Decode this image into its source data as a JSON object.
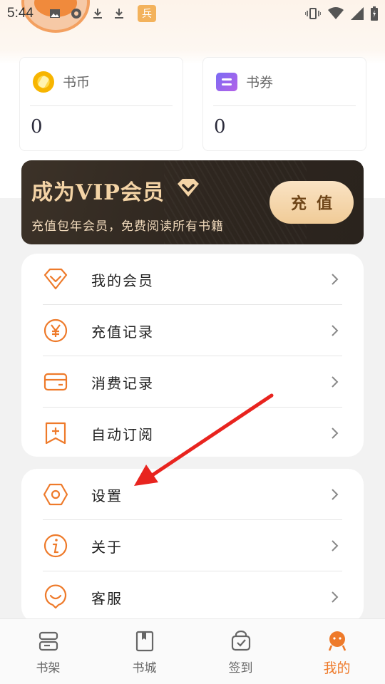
{
  "status_bar": {
    "time": "5:44",
    "notif_pill": "兵"
  },
  "wallet": {
    "coins": {
      "label": "书币",
      "value": "0",
      "icon": "coin-icon"
    },
    "tickets": {
      "label": "书券",
      "value": "0",
      "icon": "ticket-icon"
    }
  },
  "vip_banner": {
    "title": "成为VIP会员",
    "subtitle": "充值包年会员，免费阅读所有书籍",
    "button_label": "充值",
    "colors": {
      "title": "#f4d4a6",
      "button_bg": "#f0cb97",
      "background": "#2e261f"
    }
  },
  "menu_group_1": [
    {
      "label": "我的会员",
      "icon": "diamond-icon"
    },
    {
      "label": "充值记录",
      "icon": "yen-icon"
    },
    {
      "label": "消费记录",
      "icon": "card-icon"
    },
    {
      "label": "自动订阅",
      "icon": "bookmark-plus-icon"
    }
  ],
  "menu_group_2": [
    {
      "label": "设置",
      "icon": "settings-hexagon-icon"
    },
    {
      "label": "关于",
      "icon": "info-icon"
    },
    {
      "label": "客服",
      "icon": "customer-service-icon"
    }
  ],
  "bottom_nav": [
    {
      "label": "书架",
      "icon": "bookshelf-icon",
      "active": false
    },
    {
      "label": "书城",
      "icon": "book-store-icon",
      "active": false
    },
    {
      "label": "签到",
      "icon": "checkin-bag-icon",
      "active": false
    },
    {
      "label": "我的",
      "icon": "profile-icon",
      "active": true
    }
  ],
  "colors": {
    "accent": "#ee7a2a",
    "annotation_arrow": "#e8241f"
  }
}
